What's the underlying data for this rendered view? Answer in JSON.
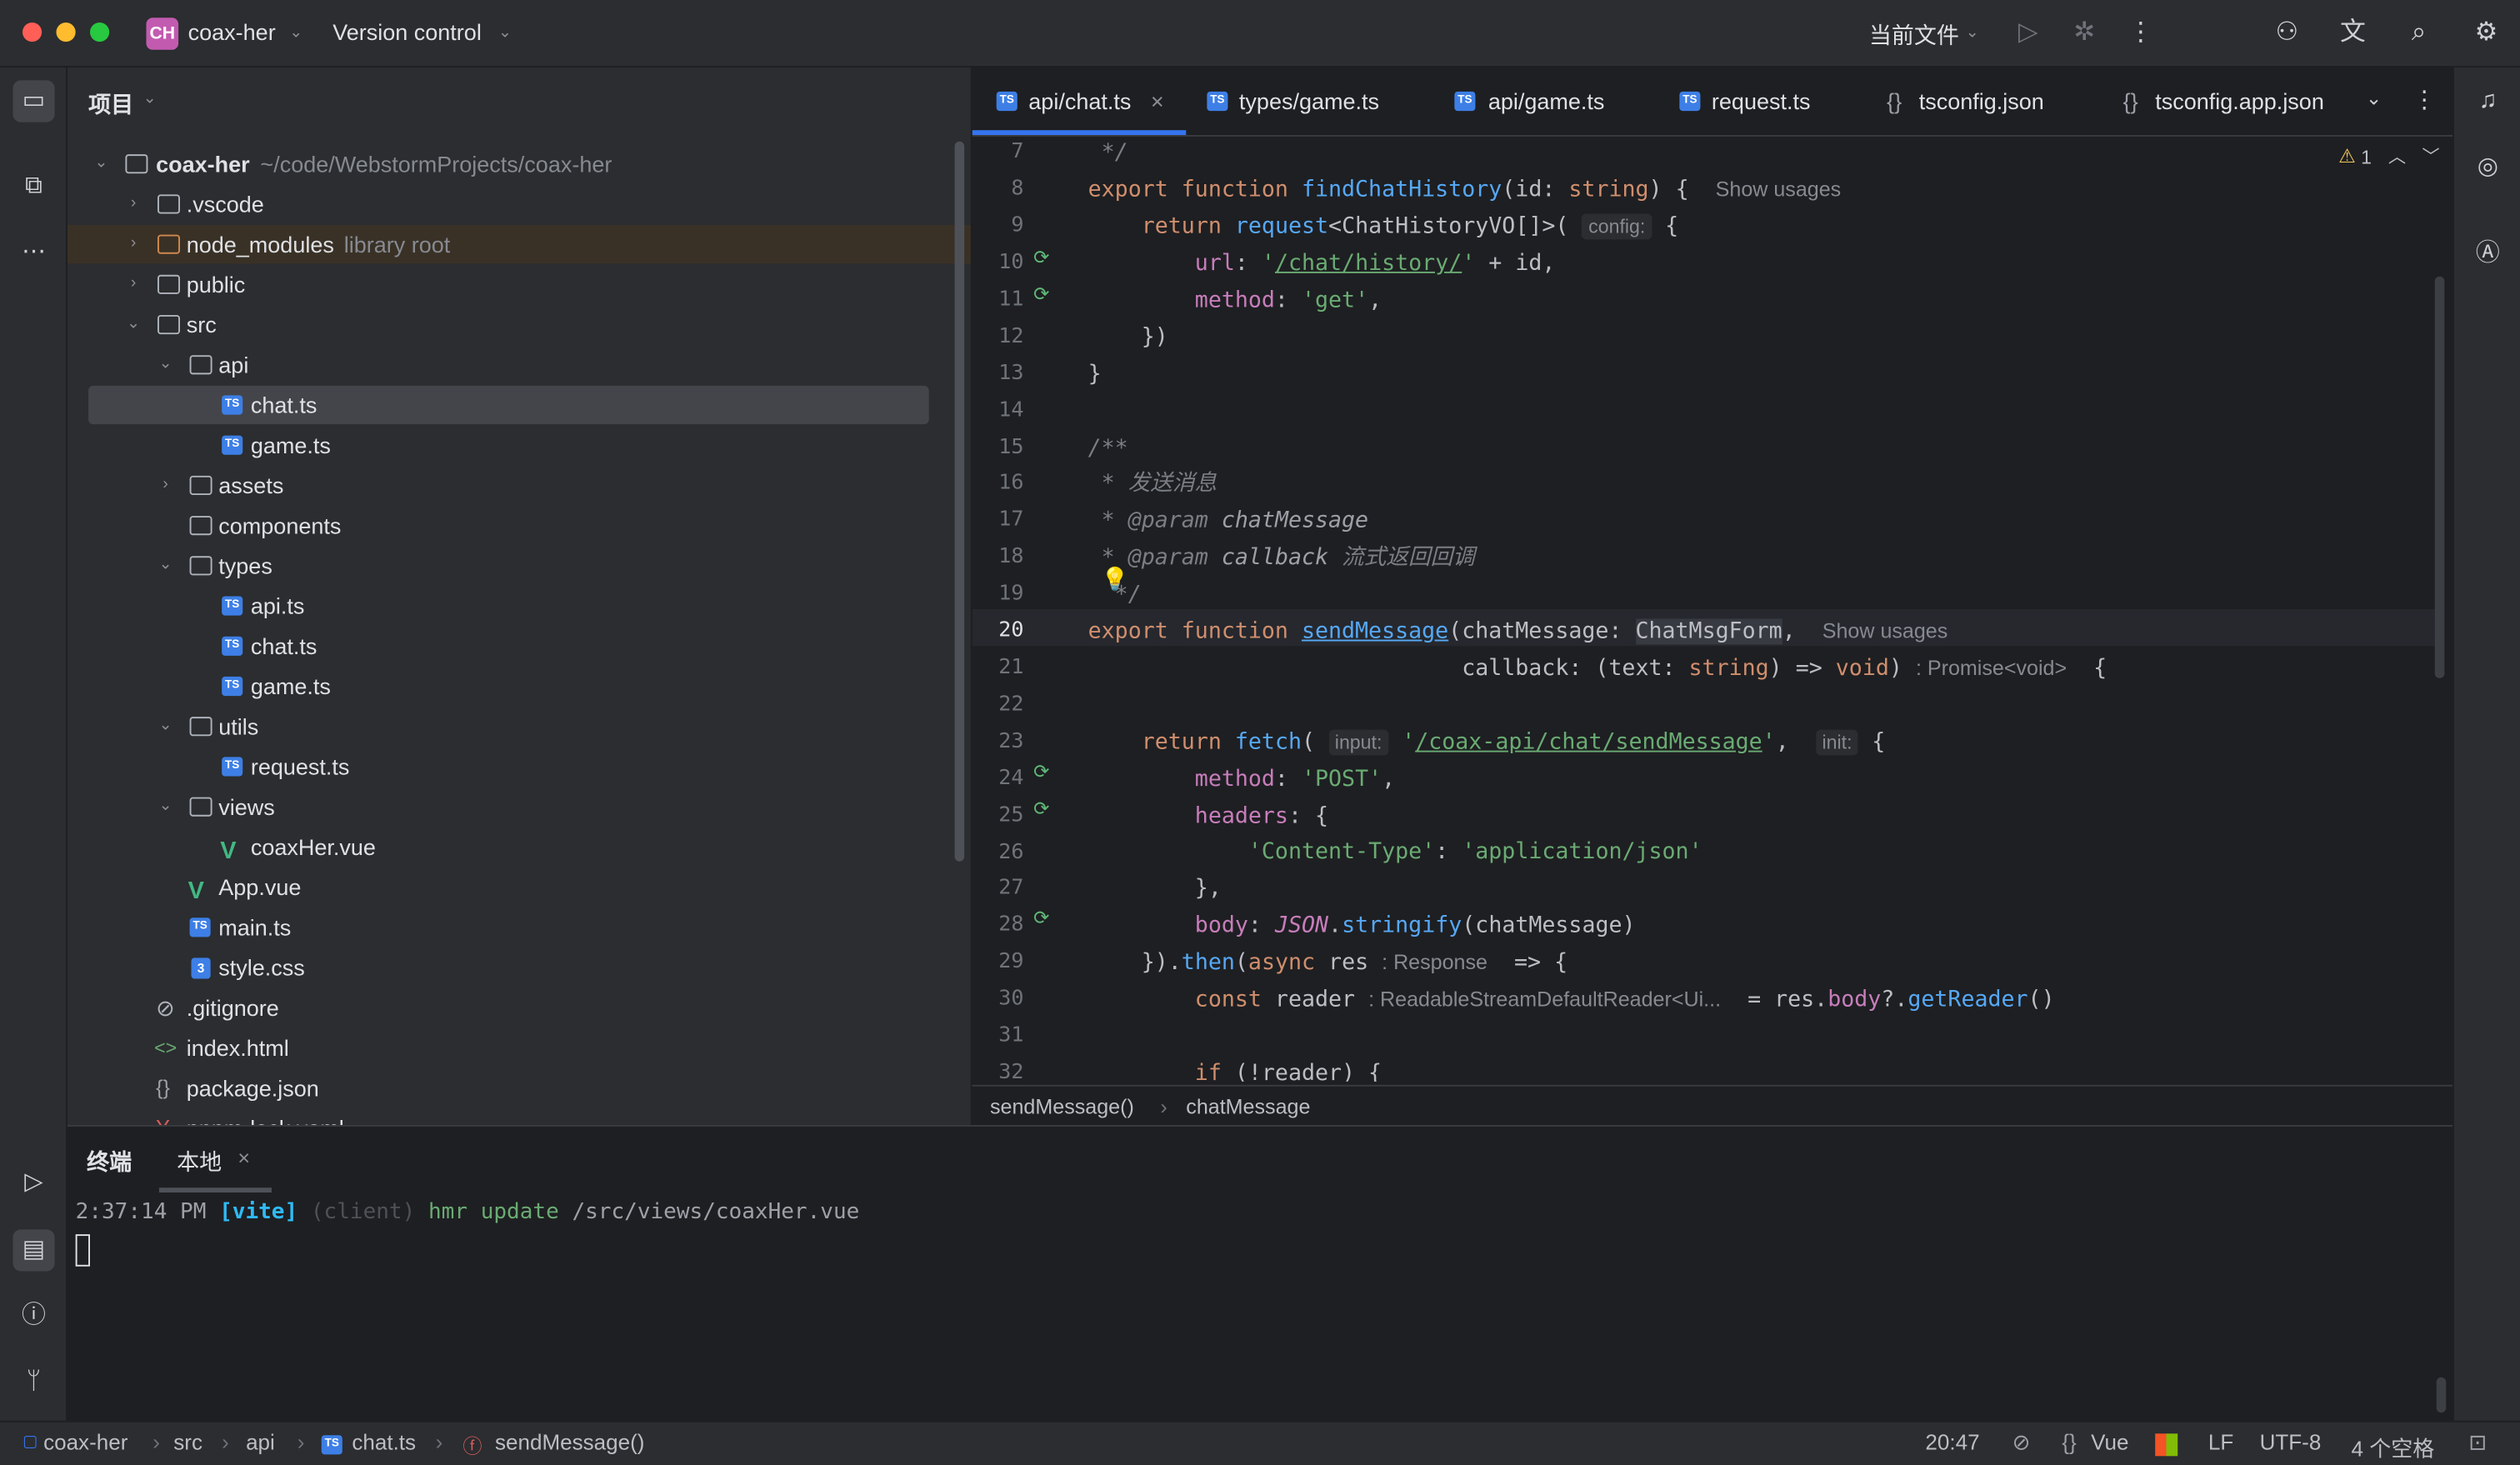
{
  "titlebar": {
    "project_badge": "CH",
    "project_name": "coax-her",
    "vcs": "Version control",
    "run_config": "当前文件"
  },
  "project_panel": {
    "title": "项目",
    "root_name": "coax-her",
    "root_path": "~/code/WebstormProjects/coax-her",
    "items": [
      {
        "name": ".vscode",
        "kind": "folder"
      },
      {
        "name": "node_modules",
        "kind": "folder",
        "hint": "library root"
      },
      {
        "name": "public",
        "kind": "folder"
      },
      {
        "name": "src",
        "kind": "folder"
      },
      {
        "name": "api",
        "kind": "folder"
      },
      {
        "name": "chat.ts",
        "kind": "ts"
      },
      {
        "name": "game.ts",
        "kind": "ts"
      },
      {
        "name": "assets",
        "kind": "folder"
      },
      {
        "name": "components",
        "kind": "folder"
      },
      {
        "name": "types",
        "kind": "folder"
      },
      {
        "name": "api.ts",
        "kind": "ts"
      },
      {
        "name": "chat.ts",
        "kind": "ts"
      },
      {
        "name": "game.ts",
        "kind": "ts"
      },
      {
        "name": "utils",
        "kind": "folder"
      },
      {
        "name": "request.ts",
        "kind": "ts"
      },
      {
        "name": "views",
        "kind": "folder"
      },
      {
        "name": "coaxHer.vue",
        "kind": "vue"
      },
      {
        "name": "App.vue",
        "kind": "vue"
      },
      {
        "name": "main.ts",
        "kind": "ts"
      },
      {
        "name": "style.css",
        "kind": "css"
      },
      {
        "name": ".gitignore",
        "kind": "ignore"
      },
      {
        "name": "index.html",
        "kind": "html"
      },
      {
        "name": "package.json",
        "kind": "json"
      },
      {
        "name": "pnpm-lock.yaml",
        "kind": "yaml"
      }
    ]
  },
  "editor": {
    "tabs": [
      {
        "label": "api/chat.ts",
        "active": true
      },
      {
        "label": "types/game.ts"
      },
      {
        "label": "api/game.ts"
      },
      {
        "label": "request.ts"
      },
      {
        "label": "tsconfig.json"
      },
      {
        "label": "tsconfig.app.json"
      }
    ],
    "warning_count": "1",
    "line_numbers": [
      "7",
      "8",
      "9",
      "10",
      "11",
      "12",
      "13",
      "14",
      "15",
      "16",
      "17",
      "18",
      "19",
      "20",
      "21",
      "22",
      "23",
      "24",
      "25",
      "26",
      "27",
      "28",
      "29",
      "30",
      "31",
      "32"
    ],
    "current_line": "20",
    "hints": {
      "show_usages": "Show usages",
      "config": "config:",
      "promise_void": ": Promise<void>",
      "input": "input:",
      "init": "init:",
      "response": ": Response",
      "reader_type": ": ReadableStreamDefaultReader<Ui..."
    },
    "comment_doc": "发送消息",
    "comment_cb": "流式返回回调",
    "breadcrumb": [
      "sendMessage()",
      "chatMessage"
    ]
  },
  "terminal": {
    "tab_main": "终端",
    "tab_local": "本地",
    "time": "2:37:14 PM",
    "vite": "[vite]",
    "client": "(client)",
    "msg": "hmr update",
    "path": "/src/views/coaxHer.vue"
  },
  "statusbar": {
    "crumbs": [
      "coax-her",
      "src",
      "api",
      "chat.ts",
      "sendMessage()"
    ],
    "position": "20:47",
    "language": "Vue",
    "line_sep": "LF",
    "encoding": "UTF-8",
    "indent": "4 个空格"
  }
}
